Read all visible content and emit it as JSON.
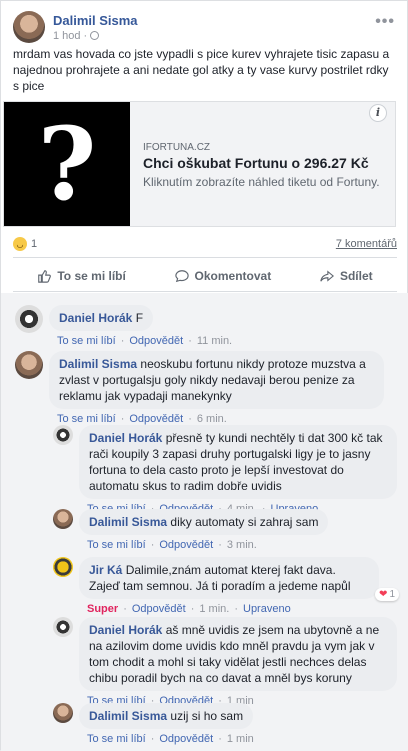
{
  "post": {
    "author": "Dalimil Sisma",
    "time": "1 hod",
    "more_icon": "more-dots-icon",
    "text": "mrdam vas hovada co jste vypadli s pice kurev vyhrajete tisic zapasu a najednou prohrajete a ani nedate gol atky a ty vase kurvy postrilet rdky s pice",
    "link": {
      "image_glyph": "?",
      "domain": "IFORTUNA.CZ",
      "title": "Chci oškubat Fortunu o 296.27 Kč",
      "description": "Kliknutím zobrazíte náhled tiketu od Fortuny."
    },
    "reaction_count": "1",
    "comments_label": "7 komentářů",
    "actions": {
      "like": "To se mi líbí",
      "comment": "Okomentovat",
      "share": "Sdílet"
    }
  },
  "comments": [
    {
      "author": "Daniel Horák",
      "text": "F",
      "like": "To se mi líbí",
      "reply": "Odpovědět",
      "time": "11 min."
    },
    {
      "author": "Dalimil Sisma",
      "text": "neoskubu fortunu nikdy protoze muzstva a zvlast v portugalsju goly nikdy nedavaji berou penize za reklamu jak vypadaji manekynky",
      "like": "To se mi líbí",
      "reply": "Odpovědět",
      "time": "6 min."
    },
    {
      "author": "Daniel Horák",
      "text": "přesně ty kundi nechtěly ti dat 300 kč tak rači koupily 3 zapasi druhy portugalski ligy je to jasny fortuna to dela casto proto je lepší investovat do automatu skus to radim dobře uvidis",
      "like": "To se mi líbí",
      "reply": "Odpovědět",
      "time": "4 min.",
      "edited": "Upraveno"
    },
    {
      "author": "Dalimil Sisma",
      "text": "diky automaty si zahraj sam",
      "like": "To se mi líbí",
      "reply": "Odpovědět",
      "time": "3 min."
    },
    {
      "author": "Jir Ká",
      "text": "Dalimile,znám automat kterej fakt dava. Zajeď tam semnou. Já ti poradím a jedeme napůl",
      "reaction": "Super",
      "reply": "Odpovědět",
      "time": "1 min.",
      "edited": "Upraveno",
      "reaction_count": "1"
    },
    {
      "author": "Daniel Horák",
      "text": "aš mně uvidis ze jsem na ubytovně a ne na azilovim dome uvidis kdo mněl pravdu ja vym jak v tom chodit a mohl si taky vidělat jestli nechces delas chibu poradil bych na co davat a mněl bys koruny",
      "like": "To se mi líbí",
      "reply": "Odpovědět",
      "time": "1 min"
    },
    {
      "author": "Dalimil Sisma",
      "text": "uzij si ho sam",
      "like": "To se mi líbí",
      "reply": "Odpovědět",
      "time": "1 min"
    }
  ]
}
